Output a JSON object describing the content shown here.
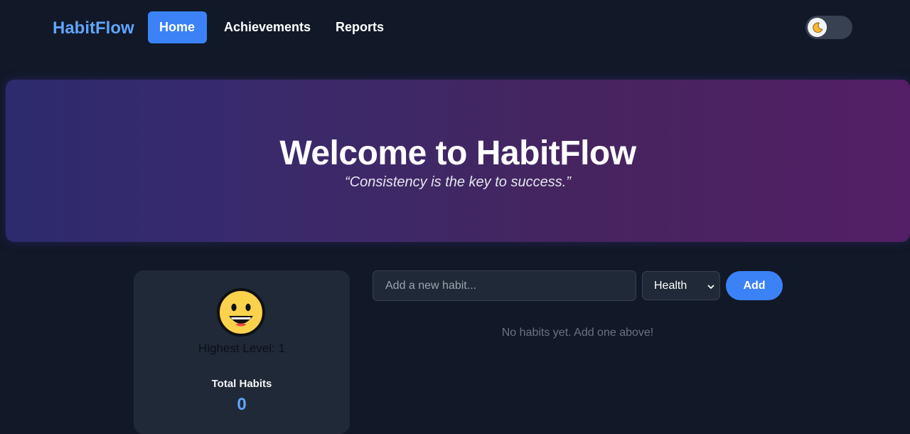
{
  "nav": {
    "brand": "HabitFlow",
    "links": [
      {
        "label": "Home",
        "active": true
      },
      {
        "label": "Achievements",
        "active": false
      },
      {
        "label": "Reports",
        "active": false
      }
    ],
    "theme_toggle_icon": "moon-icon"
  },
  "hero": {
    "title": "Welcome to HabitFlow",
    "quote": "“Consistency is the key to success.”"
  },
  "profile": {
    "avatar_icon": "smiling-face-icon",
    "level_text": "Highest Level: 1",
    "total_label": "Total Habits",
    "total_value": "0"
  },
  "add_habit": {
    "placeholder": "Add a new habit...",
    "category_selected": "Health",
    "add_label": "Add"
  },
  "habits": {
    "empty_message": "No habits yet. Add one above!"
  },
  "colors": {
    "background": "#111827",
    "accent": "#3b82f6",
    "brand": "#60a5fa",
    "card": "#1f2937"
  }
}
